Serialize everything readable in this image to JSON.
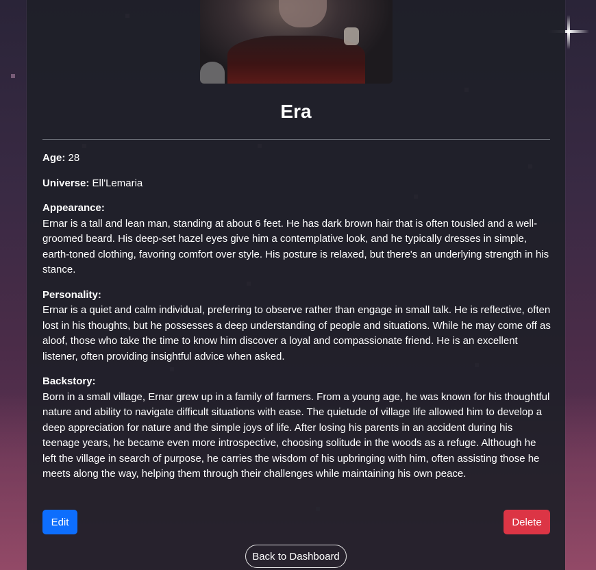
{
  "character": {
    "name": "Era",
    "age_label": "Age:",
    "age": "28",
    "universe_label": "Universe:",
    "universe": "Ell'Lemaria",
    "appearance_label": "Appearance:",
    "appearance": "Ernar is a tall and lean man, standing at about 6 feet. He has dark brown hair that is often tousled and a well-groomed beard. His deep-set hazel eyes give him a contemplative look, and he typically dresses in simple, earth-toned clothing, favoring comfort over style. His posture is relaxed, but there's an underlying strength in his stance.",
    "personality_label": "Personality:",
    "personality": "Ernar is a quiet and calm individual, preferring to observe rather than engage in small talk. He is reflective, often lost in his thoughts, but he possesses a deep understanding of people and situations. While he may come off as aloof, those who take the time to know him discover a loyal and compassionate friend. He is an excellent listener, often providing insightful advice when asked.",
    "backstory_label": "Backstory:",
    "backstory": "Born in a small village, Ernar grew up in a family of farmers. From a young age, he was known for his thoughtful nature and ability to navigate difficult situations with ease. The quietude of village life allowed him to develop a deep appreciation for nature and the simple joys of life. After losing his parents in an accident during his teenage years, he became even more introspective, choosing solitude in the woods as a refuge. Although he left the village in search of purpose, he carries the wisdom of his upbringing with him, often assisting those he meets along the way, helping them through their challenges while maintaining his own peace."
  },
  "actions": {
    "edit_label": "Edit",
    "delete_label": "Delete",
    "back_label": "Back to Dashboard"
  },
  "colors": {
    "edit": "#0d6efd",
    "delete": "#dc3545",
    "card": "#1e2028"
  }
}
